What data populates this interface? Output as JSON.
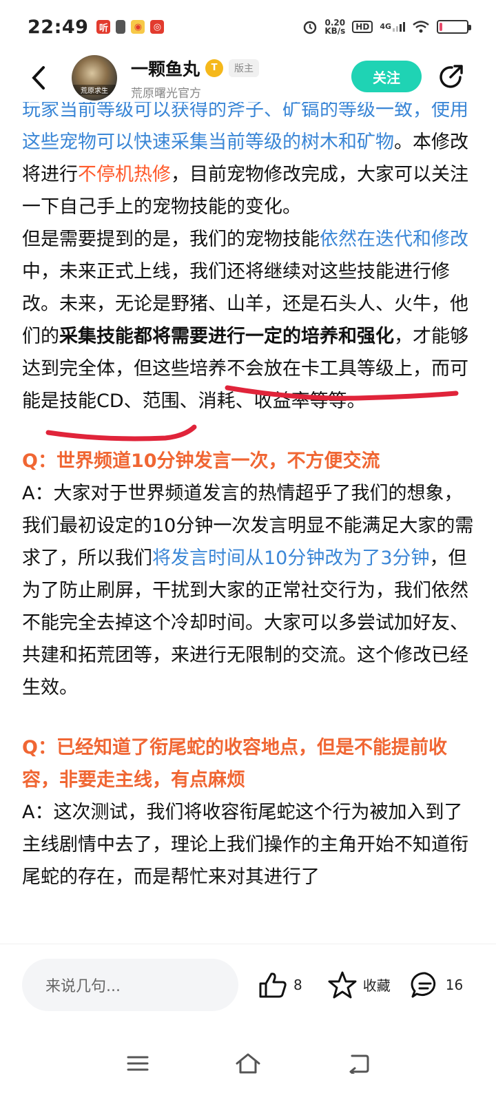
{
  "status_bar": {
    "time": "22:49",
    "net_speed_value": "0.20",
    "net_speed_unit": "KB/s",
    "hd_label": "HD",
    "signal_label": "4G",
    "icons": [
      "app-icon",
      "battery-saver-icon",
      "weibo-icon",
      "app2-icon",
      "alarm-icon",
      "hd-icon",
      "signal-icon",
      "wifi-icon",
      "battery-icon"
    ],
    "battery_level": 0.1,
    "battery_color": "#e84a6b"
  },
  "header": {
    "author_name": "一颗鱼丸",
    "level_badge": "T",
    "role_badge": "版主",
    "subtitle": "荒原曙光官方",
    "follow_label": "关注",
    "avatar_caption": "荒原求生",
    "follow_color": "#1fd3b4"
  },
  "article": {
    "p1_line_partial": "玩家当前等级可以获得的斧子、矿镐的等级一致，",
    "p1_blue": "使用这些宠物可以快速采集当前等级的树木和矿物",
    "p1_mid": "。本修改将进行",
    "p1_orange": "不停机热修",
    "p1_end": "，目前宠物修改完成，大家可以关注一下自己手上的宠物技能的变化。",
    "p2_start": "但是需要提到的是，我们的宠物技能",
    "p2_blue": "依然在迭代和修改",
    "p2_mid": "中，未来正式上线，我们还将继续对这些技能进行修改。未来，无论是野猪、山羊，还是石头人、火牛，他们的",
    "p2_bold": "采集技能都将需要进行一定的培养和强化",
    "p2_end": "，才能够达到完全体，但这些培养不会放在卡工具等级上，而可能是技能CD、范围、消耗、收益率等等。",
    "q1": "Q：世界频道10分钟发言一次，不方便交流",
    "a1_start": "A：大家对于世界频道发言的热情超乎了我们的想象，我们最初设定的10分钟一次发言明显不能满足大家的需求了，所以我们",
    "a1_blue": "将发言时间从10分钟改为了3分钟",
    "a1_end": "，但为了防止刷屏，干扰到大家的正常社交行为，我们依然不能完全去掉这个冷却时间。大家可以多尝试加好友、共建和拓荒团等，来进行无限制的交流。这个修改已经生效。",
    "q2": "Q：已经知道了衔尾蛇的收容地点，但是不能提前收容，非要走主线，有点麻烦",
    "a2": "A：这次测试，我们将收容衔尾蛇这个行为被加入到了主线剧情中去了，理论上我们操作的主角开始不知道衔尾蛇的存在，而是帮忙来对其进行了"
  },
  "colors": {
    "link_blue": "#3a86d6",
    "hot_orange": "#ff5a2b",
    "question_orange": "#f06633",
    "ink_red": "#e0243a"
  },
  "bottom_bar": {
    "reply_placeholder": "来说几句...",
    "like_count": "8",
    "favorite_label": "收藏",
    "comment_count": "16"
  },
  "nav_bar": {
    "icons": [
      "menu-icon",
      "home-icon",
      "back-icon"
    ]
  }
}
